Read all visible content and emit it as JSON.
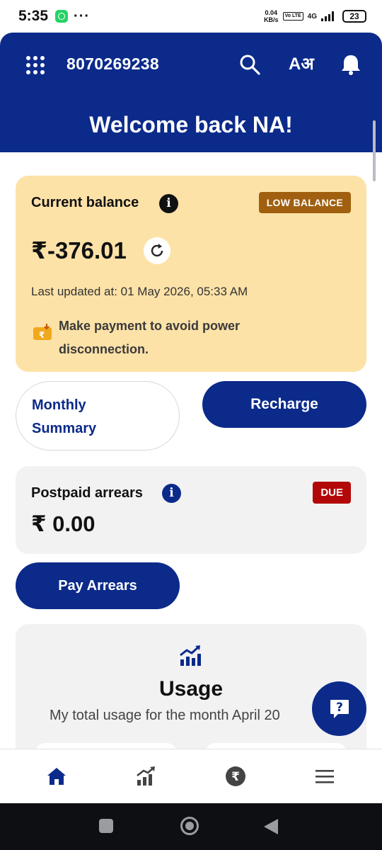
{
  "status_bar": {
    "time": "5:35",
    "dots": "···",
    "speed_value": "0.04",
    "speed_unit": "KB/s",
    "volte": "Vo LTE",
    "network": "4G",
    "battery": "23"
  },
  "header": {
    "account_number": "8070269238",
    "welcome": "Welcome back NA!",
    "icons": [
      "apps-grid-icon",
      "search-icon",
      "language-icon",
      "bell-icon"
    ],
    "language_glyph": "Aअ"
  },
  "balance": {
    "title": "Current balance",
    "info_glyph": "i",
    "badge": "LOW BALANCE",
    "amount": "₹-376.01",
    "last_updated": "Last updated at: 01 May 2026, 05:33 AM",
    "warning": "Make payment to avoid power disconnection."
  },
  "actions": {
    "monthly_summary": "Monthly Summary",
    "recharge": "Recharge",
    "pay_arrears": "Pay Arrears"
  },
  "arrears": {
    "title": "Postpaid arrears",
    "info_glyph": "i",
    "badge": "DUE",
    "amount": "₹ 0.00"
  },
  "usage": {
    "title": "Usage",
    "subtitle": "My total usage for the month April 20"
  },
  "bottom_nav": {
    "items": [
      "home-icon",
      "stats-icon",
      "rupee-icon",
      "menu-icon"
    ],
    "active": "home-icon"
  },
  "colors": {
    "brand": "#0b2a8a",
    "balance_card": "#fde2a8",
    "low_badge": "#a0600f",
    "due_badge": "#b3080a"
  }
}
